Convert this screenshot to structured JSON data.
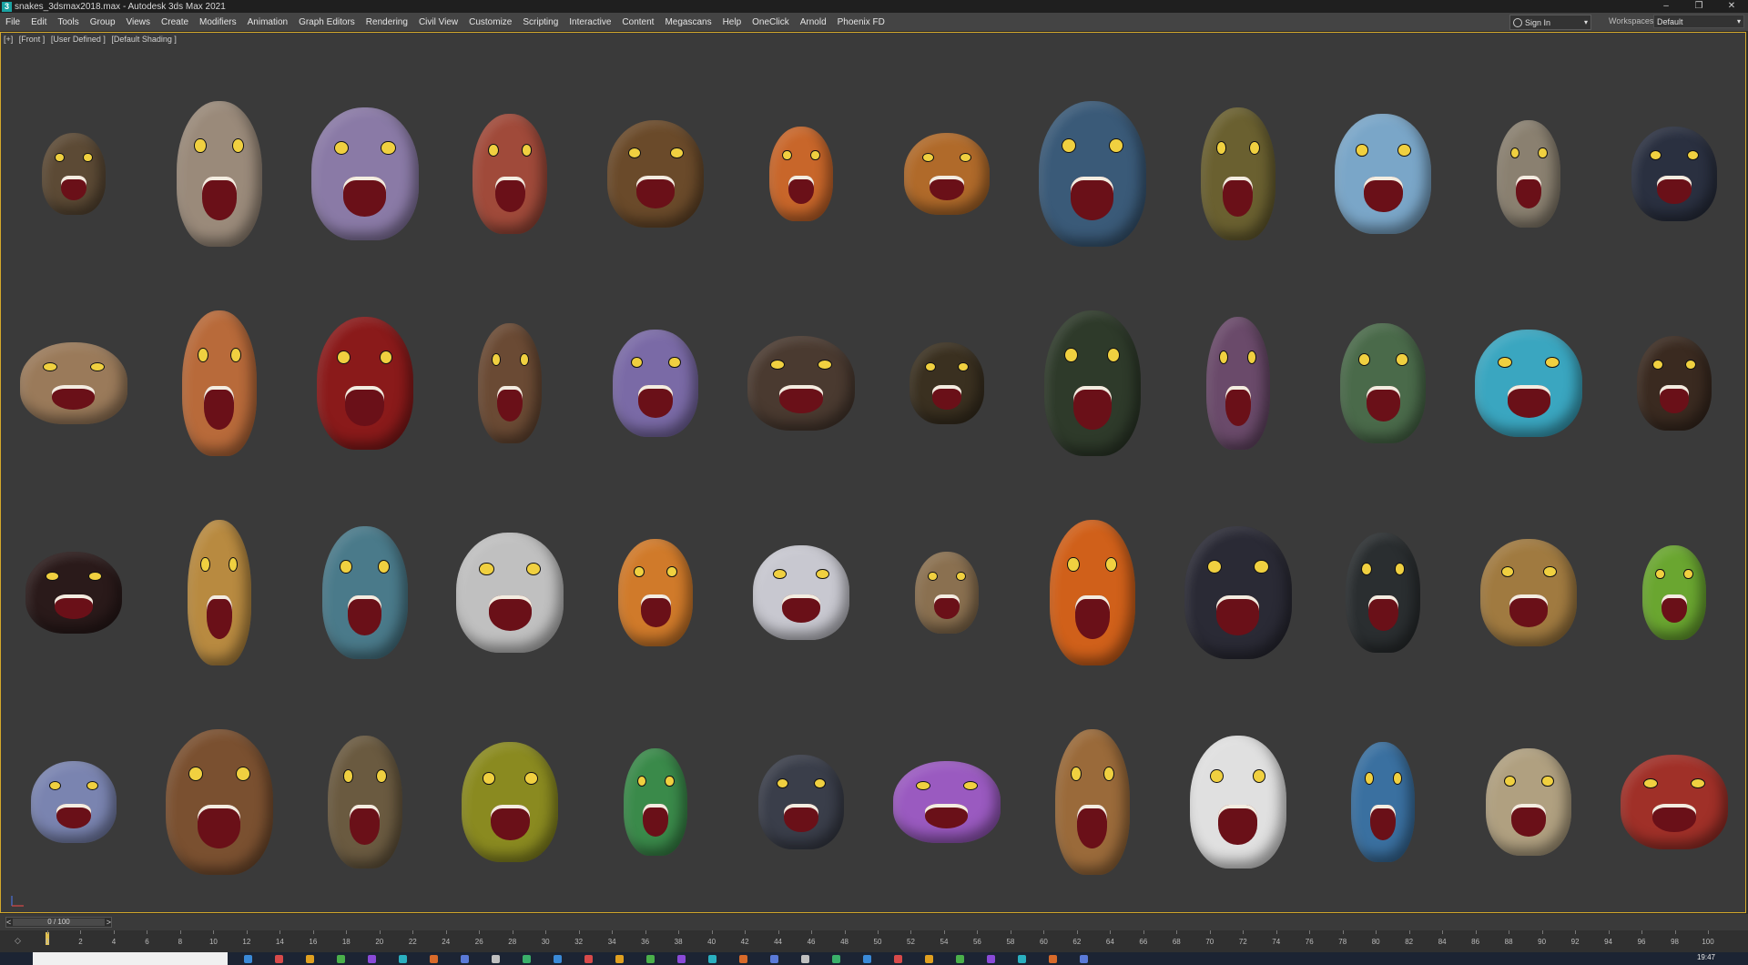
{
  "window": {
    "title": "snakes_3dsmax2018.max - Autodesk 3ds Max 2021",
    "app_icon": "3",
    "controls": [
      "–",
      "❐",
      "✕"
    ]
  },
  "menu": {
    "items": [
      "File",
      "Edit",
      "Tools",
      "Group",
      "Views",
      "Create",
      "Modifiers",
      "Animation",
      "Graph Editors",
      "Rendering",
      "Civil View",
      "Customize",
      "Scripting",
      "Interactive",
      "Content",
      "Megascans",
      "Help",
      "OneClick",
      "Arnold",
      "Phoenix FD"
    ],
    "sign_in_label": "Sign In",
    "workspaces_label": "Workspaces:",
    "workspace_value": "Default"
  },
  "viewport": {
    "labels": [
      "[+]",
      "[Front ]",
      "[User Defined ]",
      "[Default Shading ]"
    ],
    "accent_color": "#d3a82b",
    "model_count": 48
  },
  "timeline": {
    "frame_display": "0 / 100",
    "prev_label": "<",
    "next_label": ">",
    "ticks": [
      "0",
      "2",
      "4",
      "6",
      "8",
      "10",
      "12",
      "14",
      "16",
      "18",
      "20",
      "22",
      "24",
      "26",
      "28",
      "30",
      "32",
      "34",
      "36",
      "38",
      "40",
      "42",
      "44",
      "46",
      "48",
      "50",
      "52",
      "54",
      "56",
      "58",
      "60",
      "62",
      "64",
      "66",
      "68",
      "70",
      "72",
      "74",
      "76",
      "78",
      "80",
      "82",
      "84",
      "86",
      "88",
      "90",
      "92",
      "94",
      "96",
      "98",
      "100"
    ]
  },
  "taskbar": {
    "clock": "19:47"
  }
}
